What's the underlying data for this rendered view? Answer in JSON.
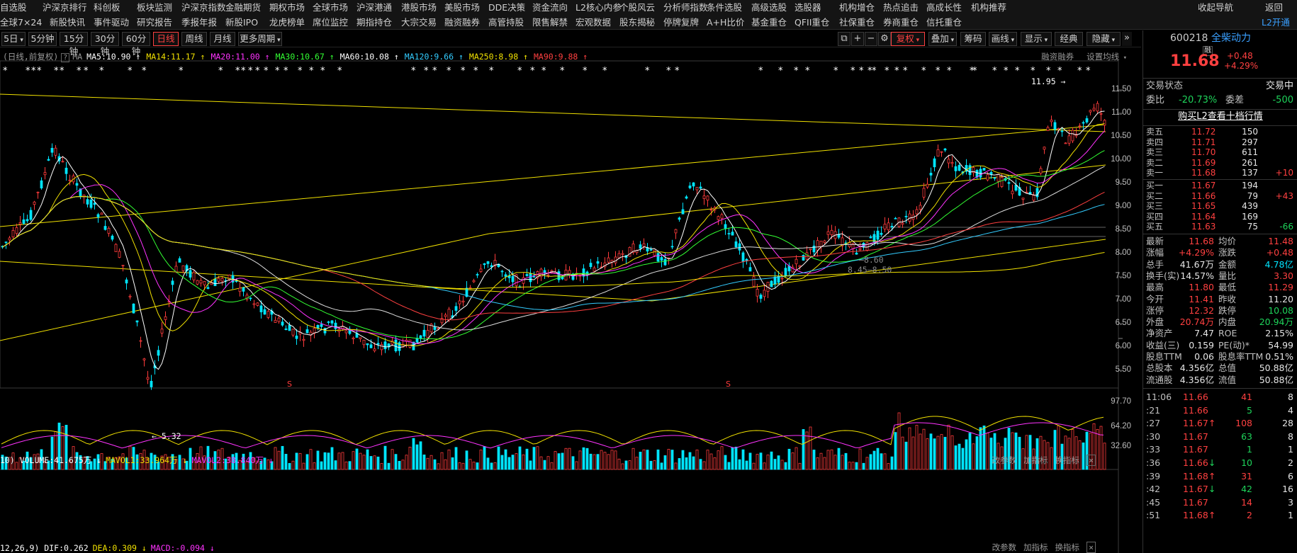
{
  "menu": {
    "row1": [
      "自选股",
      "沪深京排行",
      "科创板",
      "板块监测",
      "沪深京指数",
      "金融期货",
      "期权市场",
      "全球市场",
      "沪深港通",
      "港股市场",
      "美股市场",
      "DDE决策",
      "资金流向",
      "L2核心内参",
      "个股风云",
      "分析师指数",
      "条件选股",
      "高级选股",
      "选股器",
      "机构增仓",
      "热点追击",
      "高成长性",
      "机构推荐"
    ],
    "row1_right": [
      "收起导航",
      "返回"
    ],
    "row2": [
      "全球7×24",
      "新股快讯",
      "事件驱动",
      "研究报告",
      "季报年报",
      "新股IPO",
      "龙虎榜单",
      "席位监控",
      "期指持仓",
      "大宗交易",
      "融资融券",
      "高管持股",
      "限售解禁",
      "宏观数据",
      "股东揭秘",
      "停牌复牌",
      "A+H比价",
      "基金重仓",
      "QFII重仓",
      "社保重仓",
      "券商重仓",
      "信托重仓"
    ],
    "row2_right": [
      "L2开通"
    ]
  },
  "toolbar": {
    "periods": [
      "5日",
      "5分钟",
      "15分钟",
      "30分钟",
      "60分钟",
      "日线",
      "周线",
      "月线",
      "更多周期"
    ],
    "active_period": "日线",
    "right_buttons": [
      "复权",
      "叠加",
      "筹码",
      "画线",
      "显示",
      "经典",
      "隐藏"
    ]
  },
  "ma_legend": {
    "prefix": "(日线,前复权)",
    "ma_label": "MA",
    "items": [
      {
        "text": "MA5:10.90",
        "color": "#ffffff"
      },
      {
        "text": "MA14:11.17",
        "color": "#f0e000"
      },
      {
        "text": "MA20:11.00",
        "color": "#ff33ff"
      },
      {
        "text": "MA30:10.67",
        "color": "#33ff33"
      },
      {
        "text": "MA60:10.08",
        "color": "#ffffff"
      },
      {
        "text": "MA120:9.66",
        "color": "#33ccff"
      },
      {
        "text": "MA250:8.98",
        "color": "#f0e000"
      },
      {
        "text": "MA90:9.88",
        "color": "#ff4040"
      }
    ],
    "right_links": [
      "融资融券",
      "设置均线"
    ]
  },
  "price_axis": [
    "11.50",
    "11.00",
    "10.50",
    "10.00",
    "9.50",
    "9.00",
    "8.50",
    "8.00",
    "7.50",
    "7.00",
    "6.50",
    "6.00",
    "5.50"
  ],
  "annotations": {
    "high": "11.95",
    "low": "5.32",
    "mid1": "8.60",
    "mid2": "8.50",
    "mid_prefix": "8.45"
  },
  "volume": {
    "legend": [
      {
        "text": "10) VOLUME:41.675万",
        "color": "#ffffff"
      },
      {
        "text": "MAVOL1:33.964万",
        "color": "#f0e000"
      },
      {
        "text": "MAVOL2:38.840万",
        "color": "#ff33ff"
      }
    ],
    "links": [
      "改参数",
      "加指标",
      "换指标"
    ],
    "axis": [
      "97.70",
      "64.20",
      "32.60"
    ]
  },
  "macd": {
    "legend": [
      {
        "text": "12,26,9) DIF:0.262",
        "color": "#ffffff"
      },
      {
        "text": "DEA:0.309",
        "color": "#f0e000"
      },
      {
        "text": "MACD:-0.094",
        "color": "#ff33ff"
      }
    ],
    "links": [
      "改参数",
      "加指标",
      "换指标"
    ]
  },
  "quote": {
    "code": "600218",
    "name": "全柴动力",
    "tag": "融",
    "price": "11.68",
    "change": "+0.48",
    "change_pct": "+4.29%",
    "status_label": "交易状态",
    "status_value": "交易中",
    "weibi_label": "委比",
    "weibi_value": "-20.73%",
    "weicha_label": "委差",
    "weicha_value": "-500",
    "l2_link": "购买L2查看十档行情",
    "asks": [
      {
        "label": "卖五",
        "price": "11.72",
        "vol": "150",
        "chg": ""
      },
      {
        "label": "卖四",
        "price": "11.71",
        "vol": "297",
        "chg": ""
      },
      {
        "label": "卖三",
        "price": "11.70",
        "vol": "611",
        "chg": ""
      },
      {
        "label": "卖二",
        "price": "11.69",
        "vol": "261",
        "chg": ""
      },
      {
        "label": "卖一",
        "price": "11.68",
        "vol": "137",
        "chg": "+10"
      }
    ],
    "bids": [
      {
        "label": "买一",
        "price": "11.67",
        "vol": "194",
        "chg": ""
      },
      {
        "label": "买二",
        "price": "11.66",
        "vol": "79",
        "chg": "+43"
      },
      {
        "label": "买三",
        "price": "11.65",
        "vol": "439",
        "chg": ""
      },
      {
        "label": "买四",
        "price": "11.64",
        "vol": "169",
        "chg": ""
      },
      {
        "label": "买五",
        "price": "11.63",
        "vol": "75",
        "chg": "-66"
      }
    ],
    "stats": [
      [
        "最新",
        "11.68",
        "red",
        "均价",
        "11.48",
        "red"
      ],
      [
        "涨幅",
        "+4.29%",
        "red",
        "涨跌",
        "+0.48",
        "red"
      ],
      [
        "总手",
        "41.67万",
        "white",
        "金额",
        "4.78亿",
        "cyan"
      ],
      [
        "换手(实)",
        "14.57%",
        "white",
        "量比",
        "3.30",
        "red"
      ],
      [
        "最高",
        "11.80",
        "red",
        "最低",
        "11.29",
        "red"
      ],
      [
        "今开",
        "11.41",
        "red",
        "昨收",
        "11.20",
        "white"
      ],
      [
        "涨停",
        "12.32",
        "red",
        "跌停",
        "10.08",
        "green"
      ],
      [
        "外盘",
        "20.74万",
        "red",
        "内盘",
        "20.94万",
        "green"
      ],
      [
        "净资产",
        "7.47",
        "white",
        "ROE",
        "2.15%",
        "white"
      ],
      [
        "收益(三)",
        "0.159",
        "white",
        "PE(动)*",
        "54.99",
        "white"
      ],
      [
        "股息TTM",
        "0.06",
        "white",
        "股息率TTM",
        "0.51%",
        "white"
      ],
      [
        "总股本",
        "4.356亿",
        "white",
        "总值",
        "50.88亿",
        "white"
      ],
      [
        "流通股",
        "4.356亿",
        "white",
        "流值",
        "50.88亿",
        "white"
      ]
    ],
    "ticks": [
      {
        "time": "11:06",
        "price": "11.66",
        "arrow": "",
        "vol": "41",
        "n": "8",
        "pc": "red",
        "vc": "red"
      },
      {
        "time": ":21",
        "price": "11.66",
        "arrow": "",
        "vol": "5",
        "n": "4",
        "pc": "red",
        "vc": "green"
      },
      {
        "time": ":27",
        "price": "11.67",
        "arrow": "↑",
        "vol": "108",
        "n": "28",
        "pc": "red",
        "vc": "red"
      },
      {
        "time": ":30",
        "price": "11.67",
        "arrow": "",
        "vol": "63",
        "n": "8",
        "pc": "red",
        "vc": "green"
      },
      {
        "time": ":33",
        "price": "11.67",
        "arrow": "",
        "vol": "1",
        "n": "1",
        "pc": "red",
        "vc": "green"
      },
      {
        "time": ":36",
        "price": "11.66",
        "arrow": "↓",
        "vol": "10",
        "n": "2",
        "pc": "red",
        "vc": "green"
      },
      {
        "time": ":39",
        "price": "11.68",
        "arrow": "↑",
        "vol": "31",
        "n": "6",
        "pc": "red",
        "vc": "red"
      },
      {
        "time": ":42",
        "price": "11.67",
        "arrow": "↓",
        "vol": "42",
        "n": "16",
        "pc": "red",
        "vc": "green"
      },
      {
        "time": ":45",
        "price": "11.67",
        "arrow": "",
        "vol": "14",
        "n": "3",
        "pc": "red",
        "vc": "red"
      },
      {
        "time": ":51",
        "price": "11.68",
        "arrow": "↑",
        "vol": "2",
        "n": "1",
        "pc": "red",
        "vc": "red"
      }
    ]
  }
}
